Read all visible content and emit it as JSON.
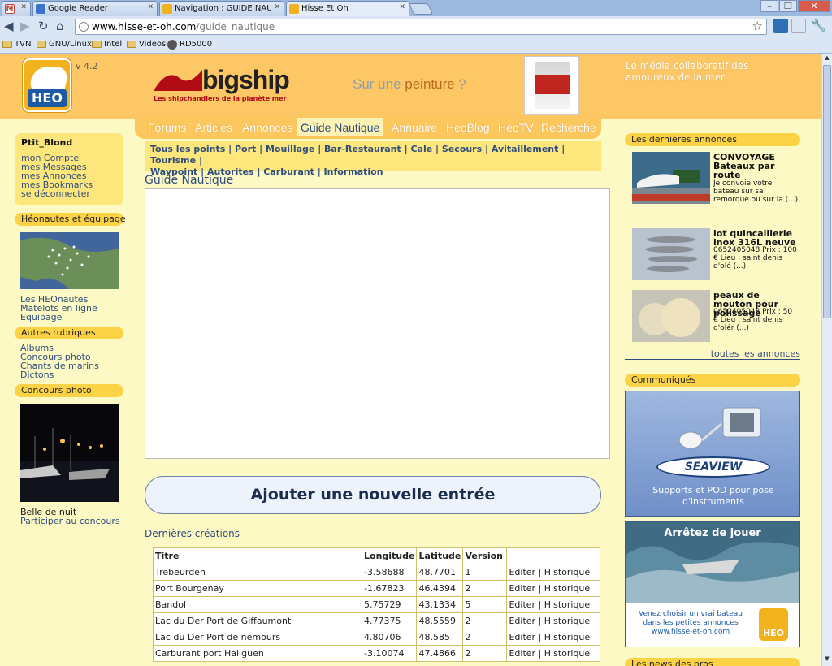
{
  "browser": {
    "tabs": [
      {
        "label": "",
        "fav": "#c63f31"
      },
      {
        "label": "Google Reader",
        "fav": "#3a73d0"
      },
      {
        "label": "Navigation : GUIDE NAUTIQUE",
        "fav": "#f0b21e"
      },
      {
        "label": "Hisse Et Oh",
        "fav": "#f0b21e"
      }
    ],
    "url_host": "www.hisse-et-oh.com",
    "url_path": "/guide_nautique",
    "bookmarks": [
      "TVN",
      "GNU/Linux",
      "Intel",
      "Videos",
      "RD5000"
    ]
  },
  "header": {
    "version": "v 4.2",
    "logo_text": "HEO",
    "sponsor_name": "bigship",
    "sponsor_tagline": "Les shipchandlers de la planète mer",
    "promo_prefix": "Sur une ",
    "promo_word": "peinture",
    "promo_suffix": " ?",
    "tagline": "Le média collaboratif des amoureux de la mer"
  },
  "nav": {
    "items": [
      "Forums",
      "Articles",
      "Annonces",
      "Guide Nautique",
      "Annuaire",
      "HeoBlog",
      "HeoTV",
      "Recherche"
    ],
    "active_index": 3,
    "sub_items": [
      "Tous les points",
      "Port",
      "Mouillage",
      "Bar-Restaurant",
      "Cale",
      "Secours",
      "Avitaillement",
      "Tourisme",
      "Waypoint",
      "Autorites",
      "Carburant",
      "Information"
    ]
  },
  "user_box": {
    "username": "Ptit_Blond",
    "links": [
      "mon Compte",
      "mes Messages",
      "mes Annonces",
      "mes Bookmarks",
      "se déconnecter"
    ]
  },
  "left": {
    "heonautes_title": "Héonautes et équipage",
    "heonautes_links": [
      "Les HEOnautes",
      "Matelots en ligne",
      "Equipage"
    ],
    "autres_title": "Autres rubriques",
    "autres_links": [
      "Albums",
      "Concours photo",
      "Chants de marins",
      "Dictons"
    ],
    "concours_title": "Concours photo",
    "concours_caption": "Belle de nuit",
    "concours_link": "Participer au concours"
  },
  "main": {
    "title": "Guide Nautique",
    "add_button": "Ajouter une nouvelle entrée",
    "recent_title": "Dernières créations",
    "table": {
      "headers": [
        "Titre",
        "Longitude",
        "Latitude",
        "Version",
        ""
      ],
      "action_edit": "Editer",
      "action_sep": " | ",
      "action_history": "Historique",
      "rows": [
        {
          "titre": "Trebeurden",
          "longitude": "-3.58688",
          "latitude": "48.7701",
          "version": "1"
        },
        {
          "titre": "Port Bourgenay",
          "longitude": "-1.67823",
          "latitude": "46.4394",
          "version": "2"
        },
        {
          "titre": "Bandol",
          "longitude": "5.75729",
          "latitude": "43.1334",
          "version": "5"
        },
        {
          "titre": "Lac du Der Port de Giffaumont",
          "longitude": "4.77375",
          "latitude": "48.5559",
          "version": "2"
        },
        {
          "titre": "Lac du Der Port de nemours",
          "longitude": "4.80706",
          "latitude": "48.585",
          "version": "2"
        },
        {
          "titre": "Carburant port Haliguen",
          "longitude": "-3.10074",
          "latitude": "47.4866",
          "version": "2"
        }
      ]
    }
  },
  "right": {
    "annonces_title": "Les dernières annonces",
    "annonces": [
      {
        "title": "CONVOYAGE Bateaux par route",
        "desc": "Je convoie votre bateau sur sa remorque ou sur la (...)"
      },
      {
        "title": "lot quincaillerie inox 316L neuve",
        "desc": "0652405048 Prix : 100 € Lieu : saint denis d'olé (...)"
      },
      {
        "title": "peaux de mouton pour polissage",
        "desc": "0652405048 Prix : 50 € Lieu : saint denis d'olér (...)"
      }
    ],
    "all_link": "toutes les annonces",
    "communiques_title": "Communiqués",
    "ad1_brand": "SEAVIEW",
    "ad1_text": "Supports et POD pour pose d'instruments",
    "ad2_title": "Arrêtez de jouer",
    "ad2_text": "Venez choisir un vrai bateau dans les petites annonces www.hisse-et-oh.com",
    "ad2_logo": "HEO",
    "bottom_title": "Les news des pros"
  }
}
